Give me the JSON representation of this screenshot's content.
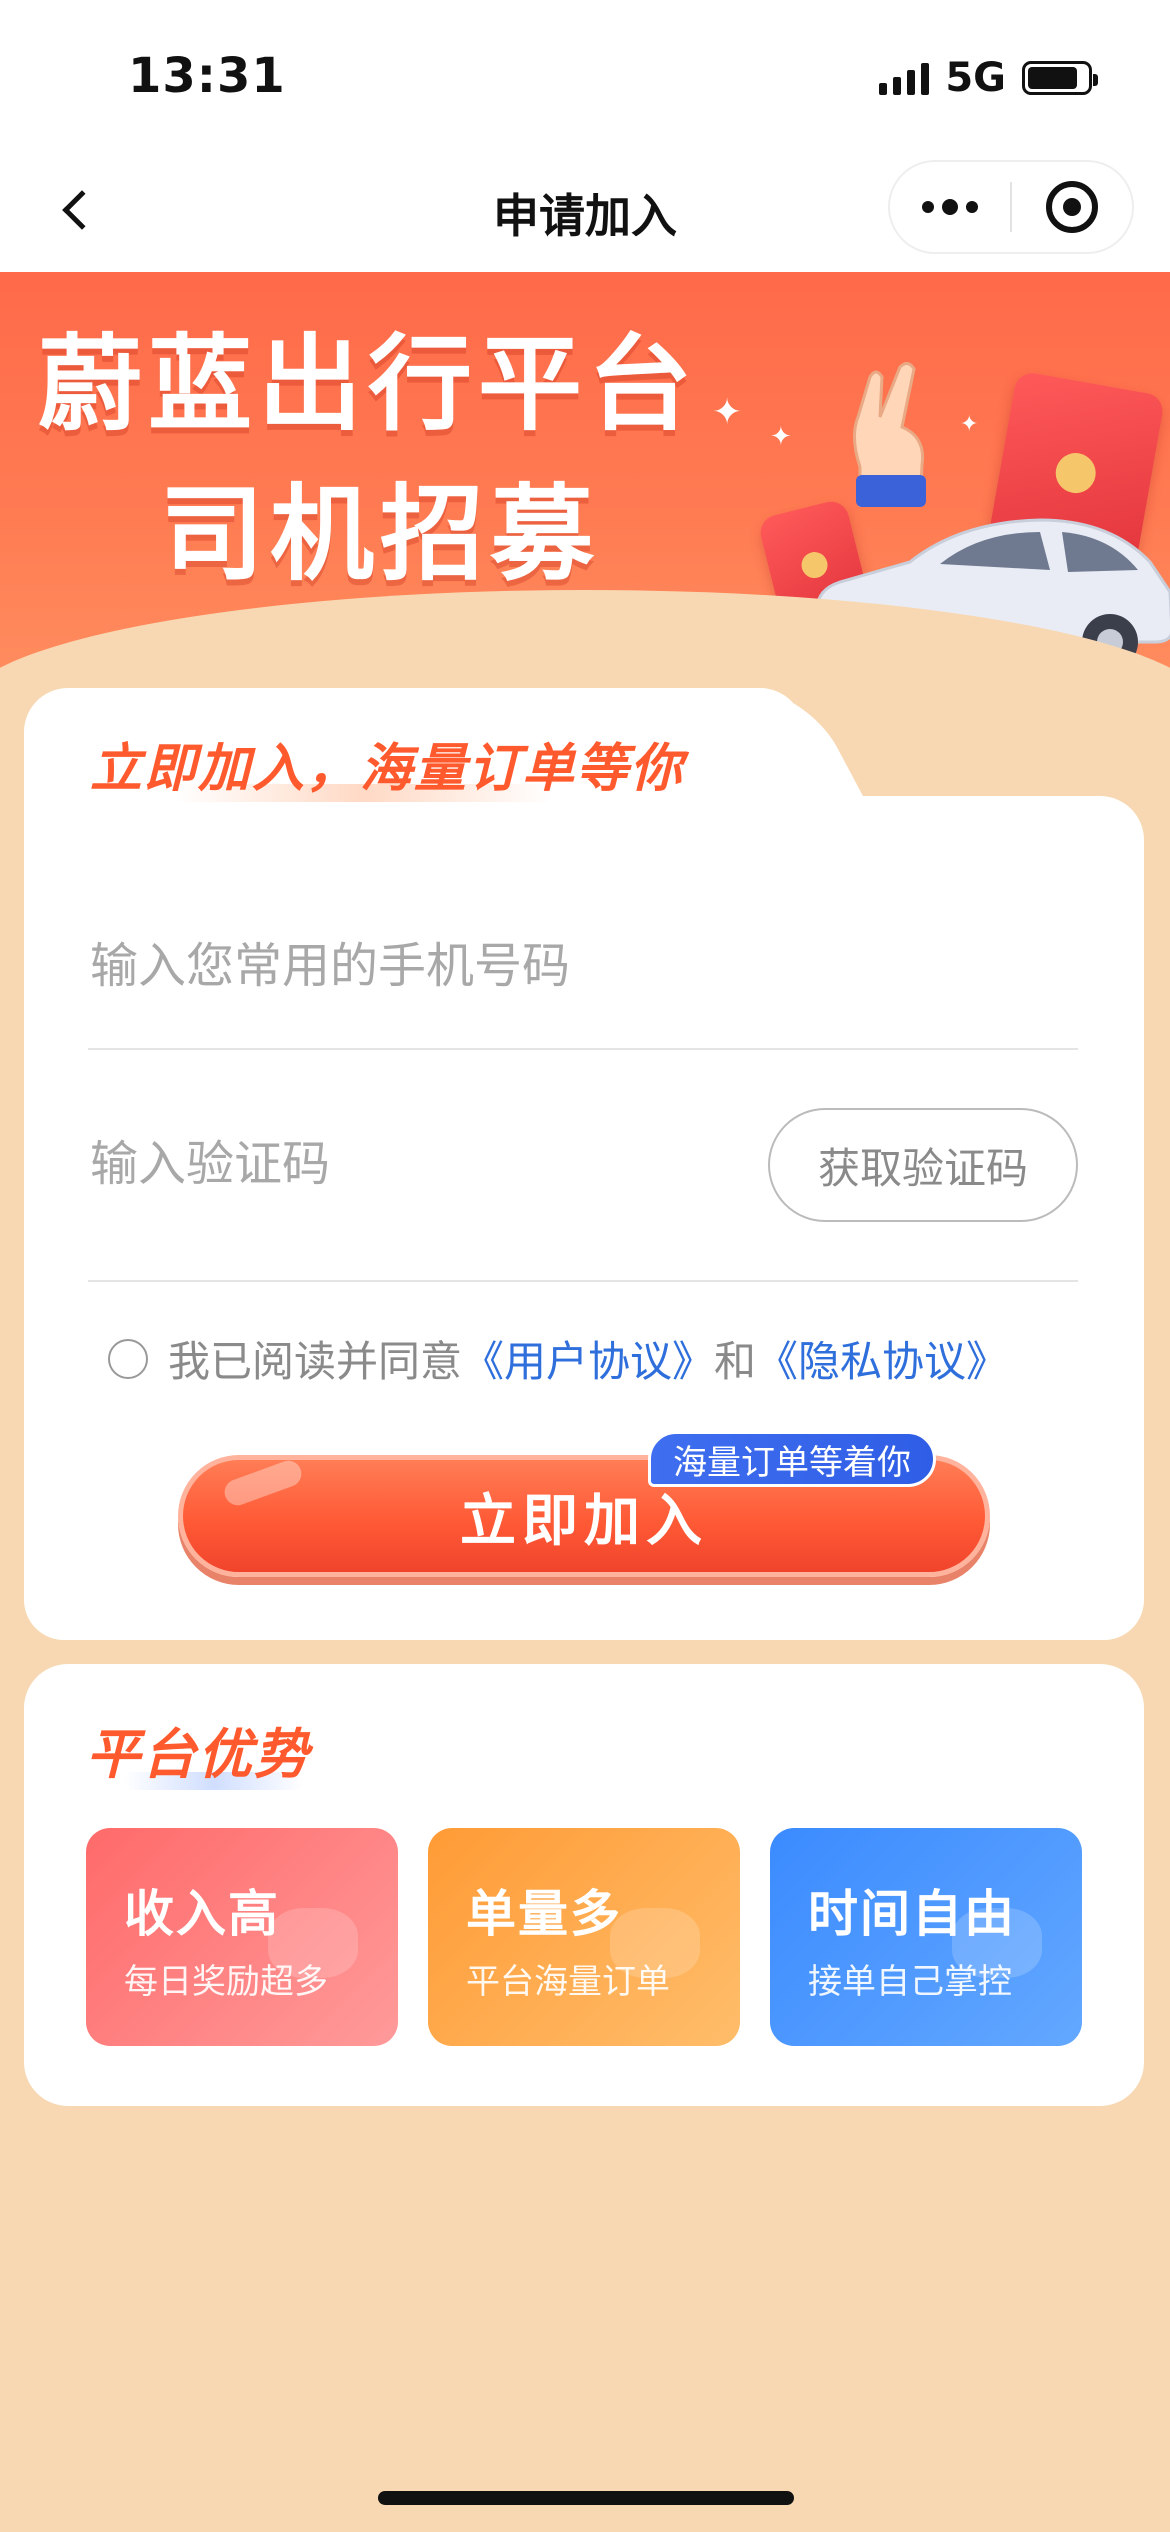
{
  "status_bar": {
    "time": "13:31",
    "network": "5G",
    "battery_level_pct": 85
  },
  "nav": {
    "title": "申请加入"
  },
  "banner": {
    "line1": "蔚蓝出行平台",
    "line2": "司机招募"
  },
  "form": {
    "heading": "立即加入，海量订单等你",
    "phone_placeholder": "输入您常用的手机号码",
    "code_placeholder": "输入验证码",
    "get_code_label": "获取验证码",
    "agree_prefix": "我已阅读并同意",
    "user_agreement": "《用户协议》",
    "and_text": "和",
    "privacy_agreement": "《隐私协议》",
    "join_label": "立即加入",
    "join_badge": "海量订单等着你"
  },
  "advantages": {
    "title": "平台优势",
    "items": [
      {
        "title": "收入高",
        "subtitle": "每日奖励超多",
        "color": "#ff7a7a"
      },
      {
        "title": "单量多",
        "subtitle": "平台海量订单",
        "color": "#ffa640"
      },
      {
        "title": "时间自由",
        "subtitle": "接单自己掌控",
        "color": "#4a95ff"
      }
    ]
  },
  "colors": {
    "accent": "#ff5a2e",
    "link": "#2f6fdc",
    "page_bg": "#f8d8b2"
  }
}
